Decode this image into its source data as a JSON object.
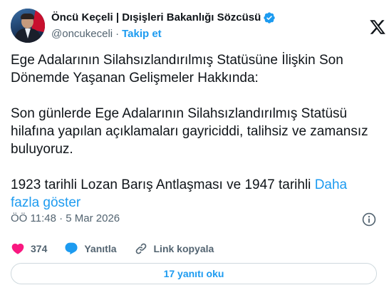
{
  "author": {
    "display_name": "Öncü Keçeli | Dışişleri Bakanlığı Sözcüsü",
    "handle": "@oncukeceli",
    "separator": "·",
    "follow_label": "Takip et"
  },
  "tweet": {
    "paragraph1": "Ege Adalarının Silahsızlandırılmış Statüsüne İlişkin Son Dönemde Yaşanan Gelişmeler Hakkında:",
    "paragraph2": "Son günlerde Ege Adalarının Silahsızlandırılmış Statüsü hilafına yapılan açıklamaları gayriciddi, talihsiz ve zamansız buluyoruz.",
    "paragraph3": "1923 tarihli Lozan Barış Antlaşması ve 1947 tarihli ",
    "show_more": "Daha fazla göster",
    "timestamp": "ÖÖ 11:48 · 5 Mar 2026"
  },
  "actions": {
    "like_count": "374",
    "reply_label": "Yanıtla",
    "copy_link_label": "Link kopyala"
  },
  "replies_button": "17 yanıtı oku",
  "colors": {
    "accent": "#1d9bf0",
    "like": "#f91880",
    "muted": "#536471",
    "text": "#0f1419",
    "border": "#cfd9de"
  },
  "icons": [
    "verified-badge-icon",
    "x-logo-icon",
    "info-icon",
    "heart-icon",
    "reply-bubble-icon",
    "link-icon"
  ]
}
